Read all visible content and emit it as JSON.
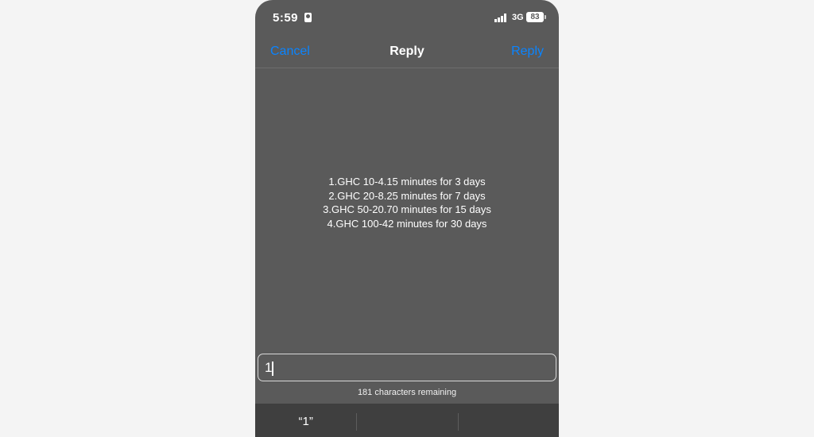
{
  "status_bar": {
    "time": "5:59",
    "network": "3G",
    "battery": "83"
  },
  "nav": {
    "cancel_label": "Cancel",
    "title": "Reply",
    "reply_label": "Reply"
  },
  "message": {
    "lines": [
      "1.GHC 10-4.15 minutes for 3 days",
      "2.GHC 20-8.25 minutes for 7 days",
      "3.GHC 50-20.70 minutes for 15 days",
      "4.GHC 100-42 minutes for 30 days"
    ]
  },
  "input": {
    "value": "1"
  },
  "remaining_text": "181 characters remaining",
  "suggestions": [
    "“1”",
    "",
    ""
  ],
  "colors": {
    "accent": "#0a84ff",
    "background": "#5a5a5a",
    "keyboard_bar": "#3f3f3f"
  }
}
